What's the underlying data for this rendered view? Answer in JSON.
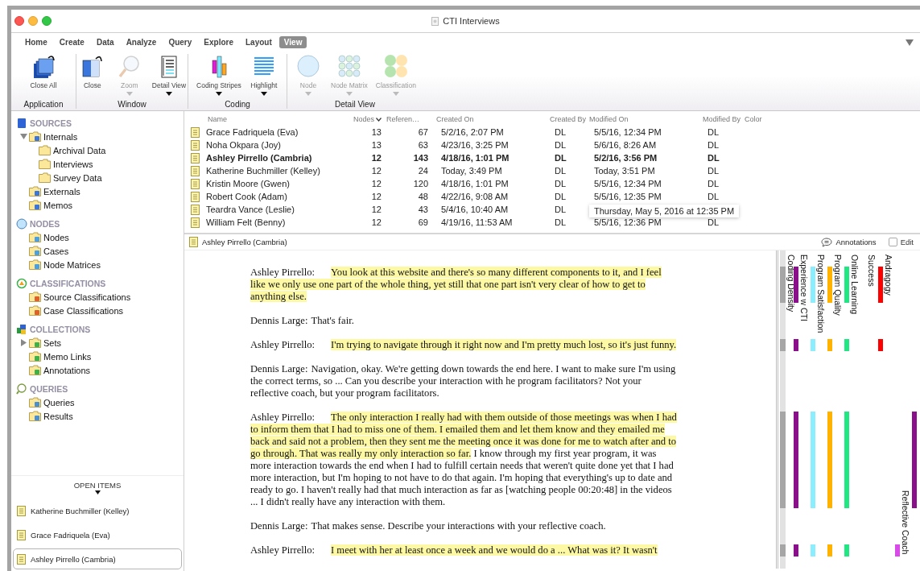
{
  "window": {
    "title": "CTI Interviews"
  },
  "ribbon_tabs": [
    {
      "label": "Home",
      "selected": false
    },
    {
      "label": "Create",
      "selected": false
    },
    {
      "label": "Data",
      "selected": false
    },
    {
      "label": "Analyze",
      "selected": false
    },
    {
      "label": "Query",
      "selected": false
    },
    {
      "label": "Explore",
      "selected": false
    },
    {
      "label": "Layout",
      "selected": false
    },
    {
      "label": "View",
      "selected": true
    }
  ],
  "ribbon_groups": [
    {
      "label": "Application",
      "buttons": [
        {
          "label": "Close All",
          "disabled": false,
          "dropdown": false
        }
      ]
    },
    {
      "label": "Window",
      "buttons": [
        {
          "label": "Close",
          "disabled": false,
          "dropdown": false
        },
        {
          "label": "Zoom",
          "disabled": true,
          "dropdown": true
        },
        {
          "label": "Detail View",
          "disabled": false,
          "dropdown": true
        }
      ]
    },
    {
      "label": "Coding",
      "buttons": [
        {
          "label": "Coding Stripes",
          "disabled": false,
          "dropdown": true
        },
        {
          "label": "Highlight",
          "disabled": false,
          "dropdown": true
        }
      ]
    },
    {
      "label": "Detail View",
      "buttons": [
        {
          "label": "Node",
          "disabled": true,
          "dropdown": true
        },
        {
          "label": "Node Matrix",
          "disabled": true,
          "dropdown": true
        },
        {
          "label": "Classification",
          "disabled": true,
          "dropdown": true
        }
      ]
    }
  ],
  "navigation": [
    {
      "title": "SOURCES",
      "items": [
        {
          "label": "Internals",
          "expanded": true,
          "children": [
            {
              "label": "Archival Data"
            },
            {
              "label": "Interviews"
            },
            {
              "label": "Survey Data"
            }
          ]
        },
        {
          "label": "Externals"
        },
        {
          "label": "Memos"
        }
      ]
    },
    {
      "title": "NODES",
      "items": [
        {
          "label": "Nodes"
        },
        {
          "label": "Cases"
        },
        {
          "label": "Node Matrices"
        }
      ]
    },
    {
      "title": "CLASSIFICATIONS",
      "items": [
        {
          "label": "Source Classifications"
        },
        {
          "label": "Case Classifications"
        }
      ]
    },
    {
      "title": "COLLECTIONS",
      "items": [
        {
          "label": "Sets",
          "expanded": false
        },
        {
          "label": "Memo Links"
        },
        {
          "label": "Annotations"
        }
      ]
    },
    {
      "title": "QUERIES",
      "items": [
        {
          "label": "Queries"
        },
        {
          "label": "Results"
        }
      ]
    }
  ],
  "open_items": {
    "title": "OPEN ITEMS",
    "items": [
      {
        "label": "Katherine Buchmiller (Kelley)",
        "selected": false
      },
      {
        "label": "Grace Fadriquela (Eva)",
        "selected": false
      },
      {
        "label": "Ashley Pirrello (Cambria)",
        "selected": true
      }
    ]
  },
  "table": {
    "columns": [
      {
        "label": "Name",
        "sorted": false
      },
      {
        "label": "Nodes",
        "sorted": true
      },
      {
        "label": "Referen…",
        "sorted": false
      },
      {
        "label": "Created On",
        "sorted": false
      },
      {
        "label": "Created By",
        "sorted": false
      },
      {
        "label": "Modified On",
        "sorted": false
      },
      {
        "label": "Modified By",
        "sorted": false
      },
      {
        "label": "Color",
        "sorted": false
      }
    ],
    "rows": [
      {
        "name": "Grace Fadriquela (Eva)",
        "nodes": "13",
        "references": "67",
        "created_on": "5/2/16, 2:07 PM",
        "created_by": "DL",
        "modified_on": "5/5/16, 12:34 PM",
        "modified_by": "DL",
        "active": false
      },
      {
        "name": "Noha Okpara (Joy)",
        "nodes": "13",
        "references": "63",
        "created_on": "4/23/16, 3:25 PM",
        "created_by": "DL",
        "modified_on": "5/6/16, 8:26 AM",
        "modified_by": "DL",
        "active": false
      },
      {
        "name": "Ashley Pirrello (Cambria)",
        "nodes": "12",
        "references": "143",
        "created_on": "4/18/16, 1:01 PM",
        "created_by": "DL",
        "modified_on": "5/2/16, 3:56 PM",
        "modified_by": "DL",
        "active": true
      },
      {
        "name": "Katherine Buchmiller (Kelley)",
        "nodes": "12",
        "references": "24",
        "created_on": "Today, 3:49 PM",
        "created_by": "DL",
        "modified_on": "Today, 3:51 PM",
        "modified_by": "DL",
        "active": false
      },
      {
        "name": "Kristin Moore (Gwen)",
        "nodes": "12",
        "references": "120",
        "created_on": "4/18/16, 1:01 PM",
        "created_by": "DL",
        "modified_on": "5/5/16, 12:34 PM",
        "modified_by": "DL",
        "active": false
      },
      {
        "name": "Robert Cook (Adam)",
        "nodes": "12",
        "references": "48",
        "created_on": "4/22/16, 9:08 AM",
        "created_by": "DL",
        "modified_on": "5/5/16, 12:35 PM",
        "modified_by": "DL",
        "active": false
      },
      {
        "name": "Teardra Vance (Leslie)",
        "nodes": "12",
        "references": "43",
        "created_on": "5/4/16, 10:40 AM",
        "created_by": "DL",
        "tooltip": "Thursday, May 5, 2016 at 12:35 PM",
        "active": false
      },
      {
        "name": "William Felt (Benny)",
        "nodes": "12",
        "references": "69",
        "created_on": "4/19/16, 11:53 AM",
        "created_by": "DL",
        "modified_on": "5/5/16, 12:36 PM",
        "modified_by": "DL",
        "active": false
      }
    ]
  },
  "detail": {
    "title": "Ashley Pirrello (Cambria)",
    "annotations_label": "Annotations",
    "edit": {
      "label": "Edit",
      "checked": false
    },
    "paragraphs": [
      {
        "kind": "participant",
        "speaker": "Ashley Pirrello:",
        "segments": [
          {
            "text": "You look at this website and there's so many different components to it, and I feel like we only use one part of the whole thing, yet still that one part isn't very clear of how to get to anything else.",
            "highlighted": true
          }
        ]
      },
      {
        "kind": "interviewer",
        "speaker": "Dennis Large:",
        "segments": [
          {
            "text": "That's fair.",
            "highlighted": false
          }
        ]
      },
      {
        "kind": "participant",
        "speaker": "Ashley Pirrello:",
        "segments": [
          {
            "text": "I'm trying to navigate through it right now and I'm pretty much lost, so it's just funny.",
            "highlighted": true
          }
        ]
      },
      {
        "kind": "interviewer",
        "speaker": "Dennis Large:",
        "segments": [
          {
            "text": "Navigation, okay. We're getting down towards the end here. I want to make sure I'm using the correct terms, so ... Can you describe your interaction with he program facilitators? Not your reflective coach, but your program facilitators.",
            "highlighted": false
          }
        ]
      },
      {
        "kind": "participant",
        "speaker": "Ashley Pirrello:",
        "segments": [
          {
            "text": "The only interaction I really had with them outside of those meetings was when I had to inform them that I had to miss one of them. I emailed them and let them know and they emailed me back and said not a problem, then they sent me the meeting once it was done for me to watch after and to go through. That was really my only interaction so far.",
            "highlighted": true
          },
          {
            "text": " I know through my first year program, it was more interaction towards the end when I had to fulfill certain needs that weren't quite done yet that I had more interaction, but I'm hoping to not have to do that again. I'm hoping that everything's up to date and ready to go. I haven't really had that much interaction as far as [watching people 00:20:48] in the videos ... I didn't really have any interaction with them.",
            "highlighted": false
          }
        ]
      },
      {
        "kind": "interviewer",
        "speaker": "Dennis Large:",
        "segments": [
          {
            "text": "That makes sense. Describe your interactions with your reflective coach.",
            "highlighted": false
          }
        ]
      },
      {
        "kind": "participant",
        "speaker": "Ashley Pirrello:",
        "segments": [
          {
            "text": "I meet with her at least once a week and we would do a ... What was it? It wasn't",
            "highlighted": true
          }
        ]
      }
    ],
    "density_label": "Coding Density",
    "stripes": [
      {
        "label": "Experience w CTI",
        "color": "#8a0f8a",
        "coded": [
          true,
          false,
          true,
          false,
          true,
          false,
          true
        ]
      },
      {
        "label": "Program Satisfaction",
        "color": "#8beeff",
        "coded": [
          true,
          false,
          true,
          false,
          true,
          false,
          true
        ]
      },
      {
        "label": "Program Quality",
        "color": "#ffb300",
        "coded": [
          true,
          false,
          true,
          false,
          true,
          false,
          true
        ]
      },
      {
        "label": "Online Learning",
        "color": "#1ee882",
        "coded": [
          true,
          false,
          true,
          false,
          true,
          false,
          true
        ]
      },
      {
        "label": "Success",
        "coded": [
          false,
          false,
          false,
          false,
          false,
          false,
          false
        ]
      },
      {
        "label": "Andragogy",
        "color": "#ff0000",
        "coded": [
          true,
          false,
          true,
          false,
          false,
          false,
          false
        ]
      },
      {
        "label": "Reflective Coach",
        "color": "#d94be8",
        "coded": [
          false,
          false,
          false,
          false,
          false,
          false,
          true
        ]
      },
      {
        "color": "#8a0f8a",
        "coded": [
          false,
          false,
          false,
          false,
          true,
          false,
          false
        ]
      }
    ]
  }
}
